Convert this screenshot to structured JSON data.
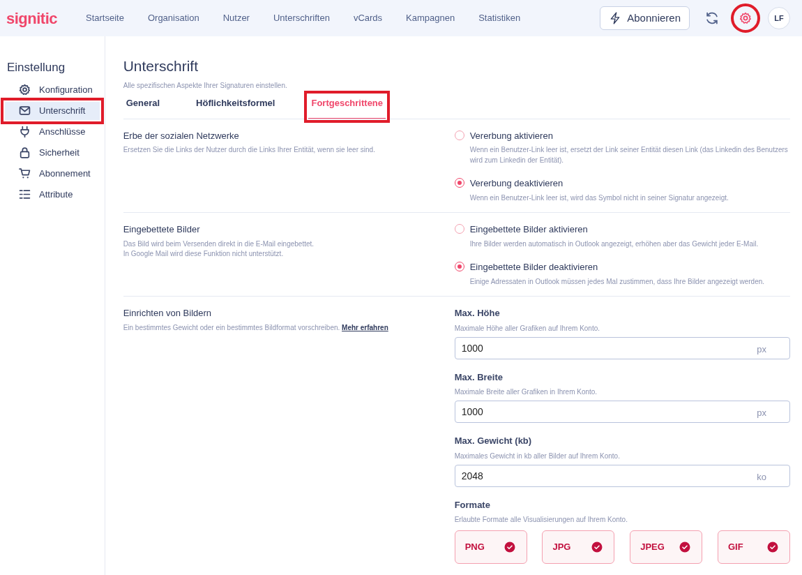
{
  "brand": {
    "logo": "signitic"
  },
  "nav": [
    {
      "label": "Startseite"
    },
    {
      "label": "Organisation"
    },
    {
      "label": "Nutzer"
    },
    {
      "label": "Unterschriften"
    },
    {
      "label": "vCards"
    },
    {
      "label": "Kampagnen"
    },
    {
      "label": "Statistiken"
    }
  ],
  "subscribe_button": {
    "label": "Abonnieren"
  },
  "settings_button": {
    "highlighted": true
  },
  "avatar": {
    "initials": "LF"
  },
  "sidebar": {
    "title": "Einstellung",
    "items": [
      {
        "label": "Konfiguration",
        "selected": false,
        "highlighted": false
      },
      {
        "label": "Unterschrift",
        "selected": true,
        "highlighted": true
      },
      {
        "label": "Anschlüsse",
        "selected": false,
        "highlighted": false
      },
      {
        "label": "Sicherheit",
        "selected": false,
        "highlighted": false
      },
      {
        "label": "Abonnement",
        "selected": false,
        "highlighted": false
      },
      {
        "label": "Attribute",
        "selected": false,
        "highlighted": false
      }
    ]
  },
  "page": {
    "title": "Unterschrift",
    "subtitle": "Alle spezifischen Aspekte Ihrer Signaturen einstellen."
  },
  "tabs": [
    {
      "label": "General",
      "selected": false,
      "highlighted": false
    },
    {
      "label": "Höflichkeitsformel",
      "selected": false,
      "highlighted": false
    },
    {
      "label": "Fortgeschrittene",
      "selected": true,
      "highlighted": true
    }
  ],
  "sections": [
    {
      "kind": "radio",
      "title": "Erbe der sozialen Netzwerke",
      "description_lines": [
        "Ersetzen Sie die Links der Nutzer durch die Links Ihrer Entität, wenn sie leer sind."
      ],
      "options": [
        {
          "label": "Vererbung aktivieren",
          "description": "Wenn ein Benutzer-Link leer ist, ersetzt der Link seiner Entität diesen Link (das Linkedin des Benutzers wird zum Linkedin der Entität).",
          "selected": false
        },
        {
          "label": "Vererbung deaktivieren",
          "description": "Wenn ein Benutzer-Link leer ist, wird das Symbol nicht in seiner Signatur angezeigt.",
          "selected": true
        }
      ]
    },
    {
      "kind": "radio",
      "title": "Eingebettete Bilder",
      "description_lines": [
        "Das Bild wird beim Versenden direkt in die E-Mail eingebettet.",
        "In Google Mail wird diese Funktion nicht unterstützt."
      ],
      "options": [
        {
          "label": "Eingebettete Bilder aktivieren",
          "description": "Ihre Bilder werden automatisch in Outlook angezeigt, erhöhen aber das Gewicht jeder E-Mail.",
          "selected": false
        },
        {
          "label": "Eingebettete Bilder deaktivieren",
          "description": "Einige Adressaten in Outlook müssen jedes Mal zustimmen, dass Ihre Bilder angezeigt werden.",
          "selected": true
        }
      ]
    },
    {
      "kind": "images",
      "title": "Einrichten von Bildern",
      "description_lines": [
        "Ein bestimmtes Gewicht oder ein bestimmtes Bildformat vorschreiben."
      ],
      "link": "Mehr erfahren",
      "fields": [
        {
          "label": "Max. Höhe",
          "hint": "Maximale Höhe aller Grafiken auf Ihrem Konto.",
          "value": "1000",
          "unit": "px"
        },
        {
          "label": "Max. Breite",
          "hint": "Maximale Breite aller Grafiken in Ihrem Konto.",
          "value": "1000",
          "unit": "px"
        },
        {
          "label": "Max. Gewicht (kb)",
          "hint": "Maximales Gewicht in kb aller Bilder auf Ihrem Konto.",
          "value": "2048",
          "unit": "ko"
        }
      ],
      "formats": {
        "label": "Formate",
        "hint": "Erlaubte Formate alle Visualisierungen auf Ihrem Konto.",
        "items": [
          {
            "label": "PNG",
            "checked": true
          },
          {
            "label": "JPG",
            "checked": true
          },
          {
            "label": "JPEG",
            "checked": true
          },
          {
            "label": "GIF",
            "checked": true
          }
        ]
      }
    }
  ]
}
